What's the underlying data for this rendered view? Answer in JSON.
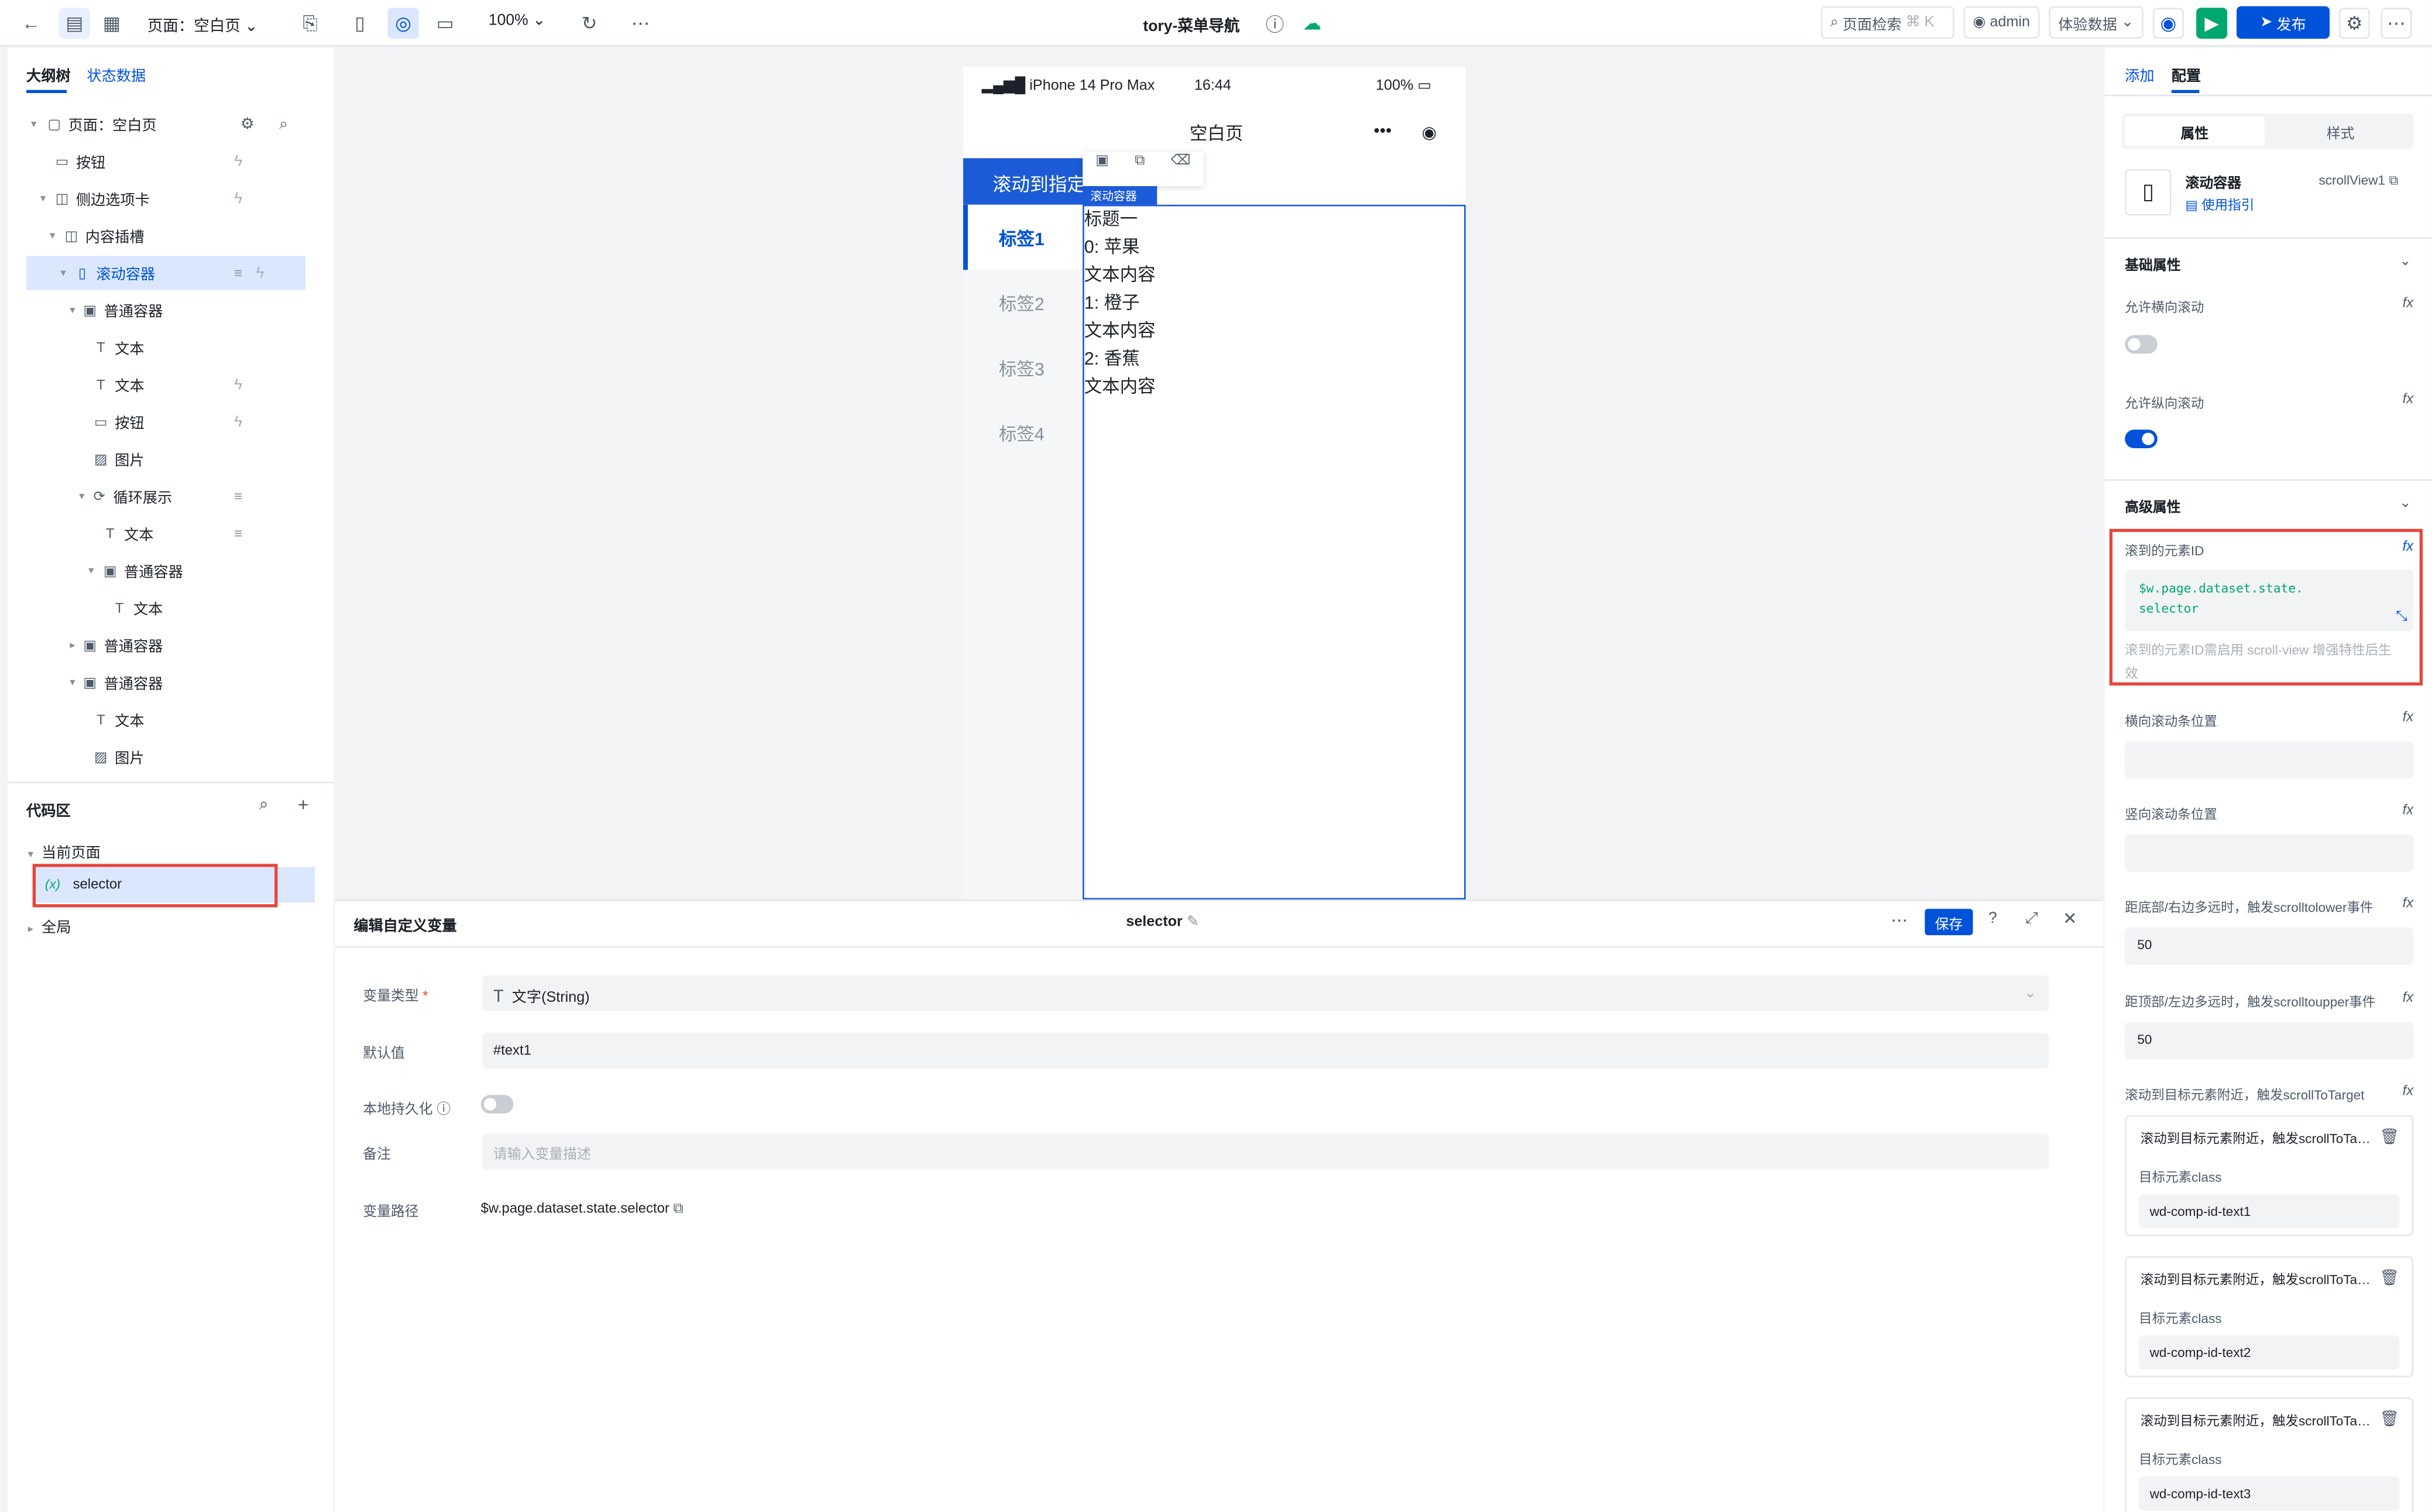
{
  "topbar": {
    "page_selector": "页面：空白页",
    "zoom": "100%",
    "title": "tory-菜单导航",
    "search": "页面检索",
    "search_shortcut": "⌘ K",
    "user": "admin",
    "experience": "体验数据",
    "publish": "发布"
  },
  "left": {
    "tabs": [
      "大纲树",
      "状态数据"
    ],
    "tree": [
      {
        "label": "页面：空白页",
        "icon": "page-icon"
      },
      {
        "label": "按钮",
        "icon": "button-icon"
      },
      {
        "label": "侧边选项卡",
        "icon": "tabs-icon"
      },
      {
        "label": "内容插槽",
        "icon": "slot-icon"
      },
      {
        "label": "滚动容器",
        "icon": "scroll-icon"
      },
      {
        "label": "普通容器",
        "icon": "container-icon"
      },
      {
        "label": "文本",
        "icon": "text-icon"
      },
      {
        "label": "文本",
        "icon": "text-icon"
      },
      {
        "label": "按钮",
        "icon": "button-icon"
      },
      {
        "label": "图片",
        "icon": "image-icon"
      },
      {
        "label": "循环展示",
        "icon": "loop-icon"
      },
      {
        "label": "文本",
        "icon": "text-icon"
      },
      {
        "label": "普通容器",
        "icon": "container-icon"
      },
      {
        "label": "文本",
        "icon": "text-icon"
      },
      {
        "label": "普通容器",
        "icon": "container-icon"
      },
      {
        "label": "普通容器",
        "icon": "container-icon"
      },
      {
        "label": "文本",
        "icon": "text-icon"
      },
      {
        "label": "图片",
        "icon": "image-icon"
      }
    ],
    "code_title": "代码区",
    "current_page": "当前页面",
    "var_name": "selector",
    "var_prefix": "(x)",
    "global": "全局"
  },
  "phone": {
    "device": "iPhone 14 Pro Max",
    "time": "16:44",
    "battery": "100%",
    "page_title": "空白页",
    "scroll_button": "滚动到指定",
    "tag": "滚动容器",
    "tabs": [
      "标签1",
      "标签2",
      "标签3",
      "标签4"
    ],
    "content": [
      "标题一",
      "0: 苹果",
      "文本内容",
      "1: 橙子",
      "文本内容",
      "2: 香蕉",
      "文本内容"
    ]
  },
  "editor": {
    "title": "编辑自定义变量",
    "var_name": "selector",
    "save": "保存",
    "type_label": "变量类型",
    "type_value": "文字(String)",
    "default_label": "默认值",
    "default_value": "#text1",
    "persist_label": "本地持久化",
    "note_label": "备注",
    "note_placeholder": "请输入变量描述",
    "path_label": "变量路径",
    "path_value": "$w.page.dataset.state.selector"
  },
  "right": {
    "tabs": [
      "添加",
      "配置"
    ],
    "subtabs": [
      "属性",
      "样式"
    ],
    "comp_name": "滚动容器",
    "comp_id": "scrollView1",
    "guide": "使用指引",
    "basic_section": "基础属性",
    "allow_h": "允许横向滚动",
    "allow_v": "允许纵向滚动",
    "adv_section": "高级属性",
    "scroll_to_id": "滚到的元素ID",
    "scroll_to_id_value1": "$w.page.dataset.state.",
    "scroll_to_id_value2": "selector",
    "scroll_to_id_hint1": "滚到的元素ID需启用 scroll-view 增强特性后生",
    "scroll_to_id_hint2": "效",
    "h_pos": "横向滚动条位置",
    "v_pos": "竖向滚动条位置",
    "lower_label": "距底部/右边多远时，触发scrolltolower事件",
    "lower_value": "50",
    "upper_label": "距顶部/左边多远时，触发scrolltoupper事件",
    "upper_value": "50",
    "target_label": "滚动到目标元素附近，触发scrollToTarget",
    "targets": [
      {
        "title": "滚动到目标元素附近，触发scrollToTarget事件",
        "class_label": "目标元素class",
        "class_value": "wd-comp-id-text1"
      },
      {
        "title": "滚动到目标元素附近，触发scrollToTarget事件",
        "class_label": "目标元素class",
        "class_value": "wd-comp-id-text2"
      },
      {
        "title": "滚动到目标元素附近，触发scrollToTarget事件",
        "class_label": "目标元素class",
        "class_value": "wd-comp-id-text3"
      }
    ]
  },
  "colors": {
    "accent": "#0052d9",
    "highlight": "#e8453c",
    "selected_bg": "#dbe7ff",
    "green": "#00a870"
  }
}
